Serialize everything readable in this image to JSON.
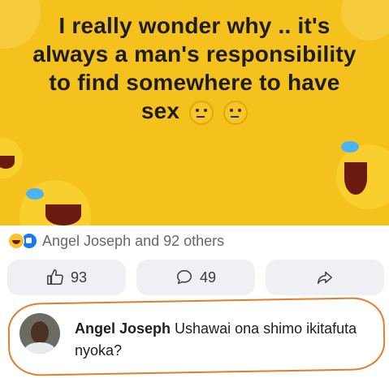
{
  "meme": {
    "line1": "I really wonder why .. it's",
    "line2": "always a man's responsibility",
    "line3": "to find somewhere to have",
    "line4": "sex",
    "emoji": "thinking-face-icon"
  },
  "reactions": {
    "icons": [
      "haha-reaction-icon",
      "like-reaction-icon"
    ],
    "text": "Angel Joseph and 92 others"
  },
  "actions": {
    "like_count": "93",
    "comment_count": "49"
  },
  "comment": {
    "author": "Angel Joseph",
    "text": "Ushawai ona shimo ikitafuta nyoka?"
  },
  "colors": {
    "meme_bg": "#f5c21d",
    "annotation_ring": "#e47d2a",
    "like_blue": "#1877f2",
    "button_bg": "#eef0f3"
  }
}
